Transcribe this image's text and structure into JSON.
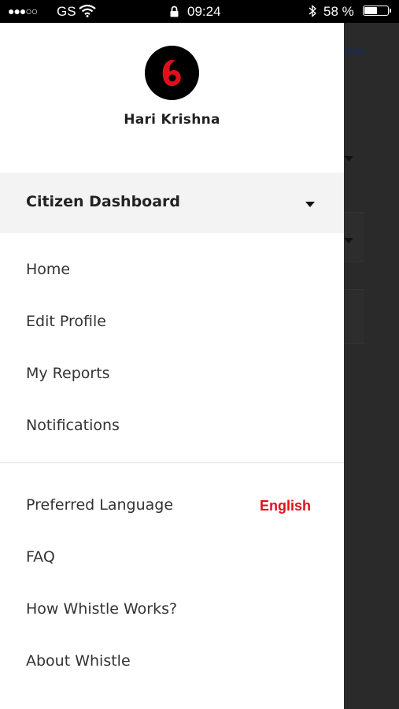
{
  "status_bar": {
    "signal": "●●●○○",
    "carrier": "GS",
    "time": "09:24",
    "battery_percent": "58 %",
    "battery_level": 0.58
  },
  "background": {
    "partial_text": "akkal"
  },
  "drawer": {
    "user_name": "Hari Krishna",
    "section_header": "Citizen Dashboard",
    "primary_items": [
      {
        "label": "Home"
      },
      {
        "label": "Edit Profile"
      },
      {
        "label": "My Reports"
      },
      {
        "label": "Notifications"
      }
    ],
    "secondary_items": [
      {
        "label": "Preferred Language",
        "value": "English"
      },
      {
        "label": "FAQ"
      },
      {
        "label": "How Whistle Works?"
      },
      {
        "label": "About Whistle"
      }
    ]
  },
  "colors": {
    "accent": "#e0101a",
    "header_bg": "#f3f3f3",
    "overlay": "#2b2b2b"
  },
  "icons": {
    "avatar": "whistle-logo-icon",
    "wifi": "wifi-icon",
    "lock": "lock-icon",
    "bluetooth": "bluetooth-icon",
    "battery": "battery-icon",
    "caret": "caret-down-icon"
  }
}
